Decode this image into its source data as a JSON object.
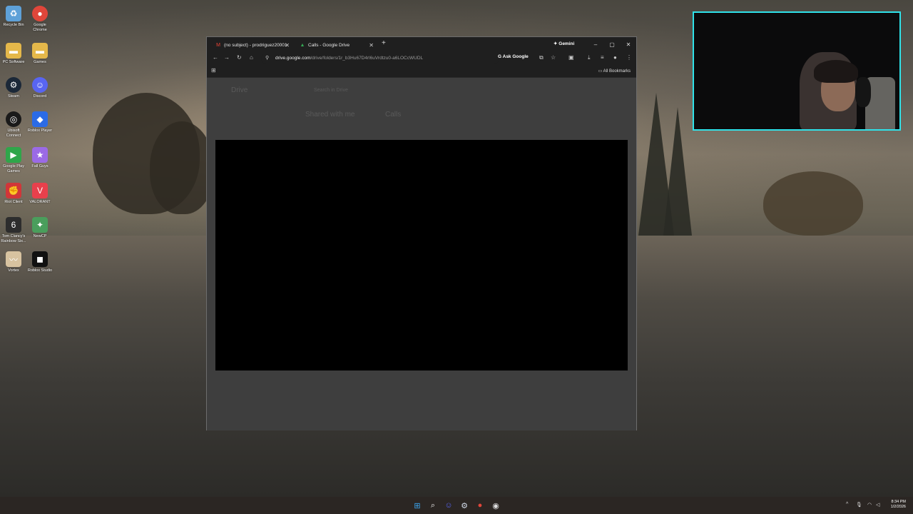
{
  "desktop": {
    "icons": [
      {
        "label": "Recycle Bin",
        "icon": "recycle-bin-icon",
        "color": "#5ea1d8"
      },
      {
        "label": "Google Chrome",
        "icon": "chrome-icon",
        "color": "#e0463a"
      },
      {
        "label": "PC Software",
        "icon": "folder-icon",
        "color": "#e5b84a"
      },
      {
        "label": "Games",
        "icon": "folder-icon",
        "color": "#e5b84a"
      },
      {
        "label": "Steam",
        "icon": "steam-icon",
        "color": "#1b2838"
      },
      {
        "label": "Discord",
        "icon": "discord-icon",
        "color": "#5865f2"
      },
      {
        "label": "Ubisoft Connect",
        "icon": "ubisoft-icon",
        "color": "#1a1a1a"
      },
      {
        "label": "Roblox Player",
        "icon": "roblox-player-icon",
        "color": "#2b6be6"
      },
      {
        "label": "Google Play Games",
        "icon": "google-play-games-icon",
        "color": "#2fa64a"
      },
      {
        "label": "Fall Guys",
        "icon": "fall-guys-icon",
        "color": "#9b6ae6"
      },
      {
        "label": "Riot Client",
        "icon": "riot-client-icon",
        "color": "#d13639"
      },
      {
        "label": "VALORANT",
        "icon": "valorant-icon",
        "color": "#e8404c"
      },
      {
        "label": "Tom Clancy's Rainbow Six...",
        "icon": "rainbow-six-icon",
        "color": "#2d2d2d"
      },
      {
        "label": "NewCP",
        "icon": "newcp-icon",
        "color": "#4a9e5c"
      },
      {
        "label": "Vortex",
        "icon": "vortex-icon",
        "color": "#d8c3a0"
      },
      {
        "label": "Roblox Studio",
        "icon": "roblox-studio-icon",
        "color": "#111111"
      }
    ]
  },
  "browser": {
    "tabs": [
      {
        "title": "(no subject) - prodriguez20001",
        "icon": "gmail-icon"
      },
      {
        "title": "Calls - Google Drive",
        "icon": "google-drive-icon"
      }
    ],
    "gemini_label": "Gemini",
    "url_host": "drive.google.com",
    "url_path": "/drive/folders/1r_b3Hu67D4rl6uVrdtzu0-a6LOCcWUDL",
    "ask_google_label": "Ask Google",
    "all_bookmarks_label": "All Bookmarks",
    "page": {
      "app_name": "Drive",
      "search_placeholder": "Search in Drive",
      "breadcrumb_root": "Shared with me",
      "breadcrumb_folder": "Calls"
    }
  },
  "taskbar": {
    "time": "8:34 PM",
    "date": "1/2/2026"
  },
  "colors": {
    "webcam_border": "#2fe3ea",
    "browser_frame": "#1f1f1f"
  }
}
